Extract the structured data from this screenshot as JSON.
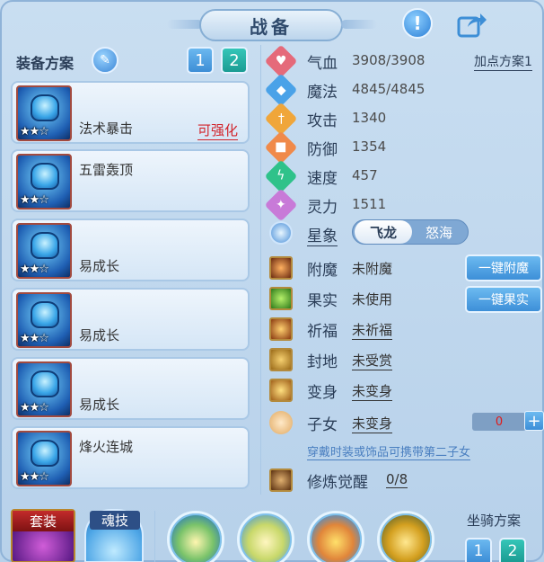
{
  "header": {
    "title": "战备",
    "info_glyph": "!",
    "share_icon": "share-icon"
  },
  "equipment": {
    "section_title": "装备方案",
    "plan_tabs": [
      "1",
      "2"
    ],
    "items": [
      {
        "name": "法术暴击",
        "stars": "★★☆",
        "tag": "可强化"
      },
      {
        "name": "五雷轰顶",
        "stars": "★★☆",
        "tag": ""
      },
      {
        "name": "易成长",
        "stars": "★★☆",
        "tag": ""
      },
      {
        "name": "易成长",
        "stars": "★★☆",
        "tag": ""
      },
      {
        "name": "易成长",
        "stars": "★★☆",
        "tag": ""
      },
      {
        "name": "烽火连城",
        "stars": "★★☆",
        "tag": ""
      }
    ]
  },
  "stats": {
    "points_plan": "加点方案1",
    "rows": [
      {
        "label": "气血",
        "value": "3908/3908",
        "color": "#e56a7a"
      },
      {
        "label": "魔法",
        "value": "4845/4845",
        "color": "#4aa2e8"
      },
      {
        "label": "攻击",
        "value": "1340",
        "color": "#f0a63a"
      },
      {
        "label": "防御",
        "value": "1354",
        "color": "#f08a4a"
      },
      {
        "label": "速度",
        "value": "457",
        "color": "#2fc28a"
      },
      {
        "label": "灵力",
        "value": "1511",
        "color": "#c87ad8"
      }
    ],
    "star_sign": {
      "label": "星象",
      "options": [
        "飞龙",
        "怒海"
      ],
      "selected": "飞龙"
    }
  },
  "extras": {
    "rows": [
      {
        "label": "附魔",
        "value": "未附魔"
      },
      {
        "label": "果实",
        "value": "未使用"
      },
      {
        "label": "祈福",
        "value": "未祈福"
      },
      {
        "label": "封地",
        "value": "未受赏"
      },
      {
        "label": "变身",
        "value": "未变身"
      },
      {
        "label": "子女",
        "value": "未变身"
      }
    ],
    "enchant_button": "一键附魔",
    "fruit_button": "一键果实",
    "child_count": "0",
    "plus": "+",
    "hint": "穿戴时装或饰品可携带第二子女",
    "cultivation": {
      "label": "修炼觉醒",
      "value": "0/8"
    }
  },
  "bottom": {
    "suit_label": "套装",
    "soul_label": "魂技",
    "mount_title": "坐骑方案",
    "mount_tabs": [
      "1",
      "2"
    ]
  }
}
